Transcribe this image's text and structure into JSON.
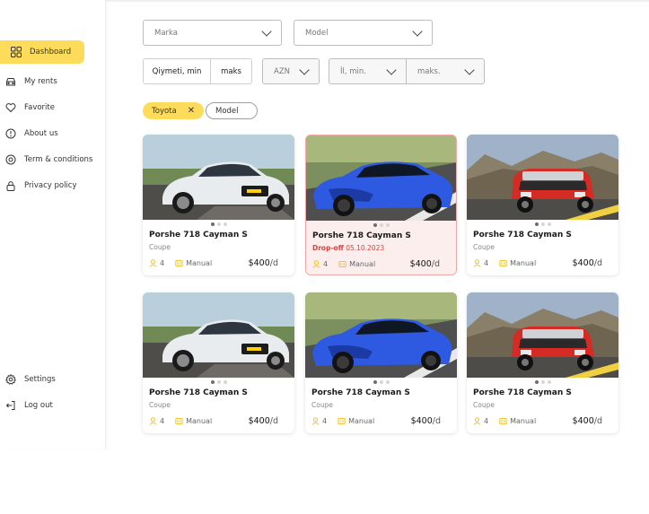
{
  "sidebar": {
    "items": [
      {
        "label": "Dashboard",
        "icon": "grid-icon",
        "active": true
      },
      {
        "label": "My rents",
        "icon": "car-icon"
      },
      {
        "label": "Favorite",
        "icon": "heart-icon"
      },
      {
        "label": "About us",
        "icon": "info-icon"
      },
      {
        "label": "Term & conditions",
        "icon": "settings-circle-icon"
      },
      {
        "label": "Privacy policy",
        "icon": "lock-icon"
      }
    ],
    "bottom": [
      {
        "label": "Settings",
        "icon": "gear-icon"
      },
      {
        "label": "Log out",
        "icon": "logout-icon"
      }
    ]
  },
  "filters": {
    "brand": "Marka",
    "model": "Model",
    "price_min": "Qiymeti, min",
    "price_max": "maks",
    "currency": "AZN",
    "year_min": "İl, min.",
    "year_max": "maks."
  },
  "chips": [
    {
      "label": "Toyota",
      "active": true
    },
    {
      "label": "Model",
      "active": false
    }
  ],
  "cars": [
    {
      "title": "Porshe 718 Cayman S",
      "subtitle": "Coupe",
      "seats": "4",
      "transmission": "Manual",
      "price": "$400",
      "unit": "/d",
      "image": "white-sedan"
    },
    {
      "title": "Porshe 718 Cayman S",
      "dropoff_label": "Drop-off",
      "dropoff_date": "05.10.2023",
      "seats": "4",
      "transmission": "Manual",
      "price": "$400",
      "unit": "/d",
      "image": "blue-supercar"
    },
    {
      "title": "Porshe 718 Cayman S",
      "subtitle": "Coupe",
      "seats": "4",
      "transmission": "Manual",
      "price": "$400",
      "unit": "/d",
      "image": "red-mini"
    },
    {
      "title": "Porshe 718 Cayman S",
      "subtitle": "Coupe",
      "seats": "4",
      "transmission": "Manual",
      "price": "$400",
      "unit": "/d",
      "image": "white-sedan"
    },
    {
      "title": "Porshe 718 Cayman S",
      "subtitle": "Coupe",
      "seats": "4",
      "transmission": "Manual",
      "price": "$400",
      "unit": "/d",
      "image": "blue-supercar"
    },
    {
      "title": "Porshe 718 Cayman S",
      "subtitle": "Coupe",
      "seats": "4",
      "transmission": "Manual",
      "price": "$400",
      "unit": "/d",
      "image": "red-mini"
    }
  ],
  "colors": {
    "accent": "#fddc5c",
    "alert": "#e0403a",
    "icon_yellow": "#f2c230"
  }
}
